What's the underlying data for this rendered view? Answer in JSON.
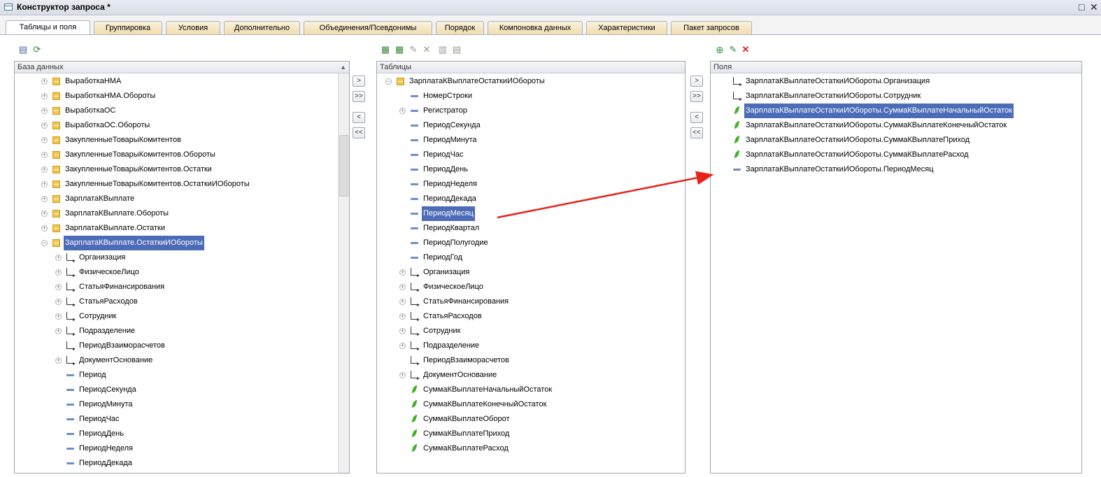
{
  "window": {
    "title": "Конструктор запроса *",
    "maximize": "□",
    "close": "✕"
  },
  "tabs": [
    {
      "label": "Таблицы и поля",
      "active": true
    },
    {
      "label": "Группировка"
    },
    {
      "label": "Условия"
    },
    {
      "label": "Дополнительно"
    },
    {
      "label": "Объединения/Псевдонимы"
    },
    {
      "label": "Порядок"
    },
    {
      "label": "Компоновка данных"
    },
    {
      "label": "Характеристики"
    },
    {
      "label": "Пакет запросов"
    }
  ],
  "database": {
    "header": "База данных",
    "items": [
      {
        "label": "ВыработкаНМА",
        "icon": "table-icon",
        "expand": "+"
      },
      {
        "label": "ВыработкаНМА.Обороты",
        "icon": "table-icon",
        "expand": "+"
      },
      {
        "label": "ВыработкаОС",
        "icon": "table-icon",
        "expand": "+"
      },
      {
        "label": "ВыработкаОС.Обороты",
        "icon": "table-icon",
        "expand": "+"
      },
      {
        "label": "ЗакупленныеТоварыКомитентов",
        "icon": "table-icon",
        "expand": "+"
      },
      {
        "label": "ЗакупленныеТоварыКомитентов.Обороты",
        "icon": "table-icon",
        "expand": "+"
      },
      {
        "label": "ЗакупленныеТоварыКомитентов.Остатки",
        "icon": "table-icon",
        "expand": "+"
      },
      {
        "label": "ЗакупленныеТоварыКомитентов.ОстаткиИОбороты",
        "icon": "table-icon",
        "expand": "+"
      },
      {
        "label": "ЗарплатаКВыплате",
        "icon": "table-icon",
        "expand": "+"
      },
      {
        "label": "ЗарплатаКВыплате.Обороты",
        "icon": "table-icon",
        "expand": "+"
      },
      {
        "label": "ЗарплатаКВыплате.Остатки",
        "icon": "table-icon",
        "expand": "+"
      },
      {
        "label": "ЗарплатаКВыплате.ОстаткиИОбороты",
        "icon": "table-icon",
        "expand": "−",
        "selected": true
      },
      {
        "label": "Организация",
        "icon": "reference-icon",
        "expand": "+",
        "child": true
      },
      {
        "label": "ФизическоеЛицо",
        "icon": "reference-icon",
        "expand": "+",
        "child": true
      },
      {
        "label": "СтатьяФинансирования",
        "icon": "reference-icon",
        "expand": "+",
        "child": true
      },
      {
        "label": "СтатьяРасходов",
        "icon": "reference-icon",
        "expand": "+",
        "child": true
      },
      {
        "label": "Сотрудник",
        "icon": "reference-icon",
        "expand": "+",
        "child": true
      },
      {
        "label": "Подразделение",
        "icon": "reference-icon",
        "expand": "+",
        "child": true
      },
      {
        "label": "ПериодВзаиморасчетов",
        "icon": "reference-icon",
        "child": true
      },
      {
        "label": "ДокументОснование",
        "icon": "reference-icon",
        "expand": "+",
        "child": true
      },
      {
        "label": "Период",
        "icon": "field-icon",
        "child": true
      },
      {
        "label": "ПериодСекунда",
        "icon": "field-icon",
        "child": true
      },
      {
        "label": "ПериодМинута",
        "icon": "field-icon",
        "child": true
      },
      {
        "label": "ПериодЧас",
        "icon": "field-icon",
        "child": true
      },
      {
        "label": "ПериодДень",
        "icon": "field-icon",
        "child": true
      },
      {
        "label": "ПериодНеделя",
        "icon": "field-icon",
        "child": true
      },
      {
        "label": "ПериодДекада",
        "icon": "field-icon",
        "child": true
      }
    ]
  },
  "tables": {
    "header": "Таблицы",
    "items": [
      {
        "label": "ЗарплатаКВыплатеОстаткиИОбороты",
        "icon": "table-icon",
        "expand": "−"
      },
      {
        "label": "НомерСтроки",
        "icon": "field-icon",
        "child": true
      },
      {
        "label": "Регистратор",
        "icon": "field-icon",
        "expand": "+",
        "child": true
      },
      {
        "label": "ПериодСекунда",
        "icon": "field-icon",
        "child": true
      },
      {
        "label": "ПериодМинута",
        "icon": "field-icon",
        "child": true
      },
      {
        "label": "ПериодЧас",
        "icon": "field-icon",
        "child": true
      },
      {
        "label": "ПериодДень",
        "icon": "field-icon",
        "child": true
      },
      {
        "label": "ПериодНеделя",
        "icon": "field-icon",
        "child": true
      },
      {
        "label": "ПериодДекада",
        "icon": "field-icon",
        "child": true
      },
      {
        "label": "ПериодМесяц",
        "icon": "field-icon",
        "child": true,
        "selected": true
      },
      {
        "label": "ПериодКвартал",
        "icon": "field-icon",
        "child": true
      },
      {
        "label": "ПериодПолугодие",
        "icon": "field-icon",
        "child": true
      },
      {
        "label": "ПериодГод",
        "icon": "field-icon",
        "child": true
      },
      {
        "label": "Организация",
        "icon": "reference-icon",
        "expand": "+",
        "child": true
      },
      {
        "label": "ФизическоеЛицо",
        "icon": "reference-icon",
        "expand": "+",
        "child": true
      },
      {
        "label": "СтатьяФинансирования",
        "icon": "reference-icon",
        "expand": "+",
        "child": true
      },
      {
        "label": "СтатьяРасходов",
        "icon": "reference-icon",
        "expand": "+",
        "child": true
      },
      {
        "label": "Сотрудник",
        "icon": "reference-icon",
        "expand": "+",
        "child": true
      },
      {
        "label": "Подразделение",
        "icon": "reference-icon",
        "expand": "+",
        "child": true
      },
      {
        "label": "ПериодВзаиморасчетов",
        "icon": "reference-icon",
        "child": true
      },
      {
        "label": "ДокументОснование",
        "icon": "reference-icon",
        "expand": "+",
        "child": true
      },
      {
        "label": "СуммаКВыплатеНачальныйОстаток",
        "icon": "resource-icon",
        "child": true
      },
      {
        "label": "СуммаКВыплатеКонечныйОстаток",
        "icon": "resource-icon",
        "child": true
      },
      {
        "label": "СуммаКВыплатеОборот",
        "icon": "resource-icon",
        "child": true
      },
      {
        "label": "СуммаКВыплатеПриход",
        "icon": "resource-icon",
        "child": true
      },
      {
        "label": "СуммаКВыплатеРасход",
        "icon": "resource-icon",
        "child": true
      }
    ]
  },
  "fields": {
    "header": "Поля",
    "items": [
      {
        "label": "ЗарплатаКВыплатеОстаткиИОбороты.Организация",
        "icon": "reference-icon"
      },
      {
        "label": "ЗарплатаКВыплатеОстаткиИОбороты.Сотрудник",
        "icon": "reference-icon"
      },
      {
        "label": "ЗарплатаКВыплатеОстаткиИОбороты.СуммаКВыплатеНачальныйОстаток",
        "icon": "resource-icon",
        "selected": true
      },
      {
        "label": "ЗарплатаКВыплатеОстаткиИОбороты.СуммаКВыплатеКонечныйОстаток",
        "icon": "resource-icon"
      },
      {
        "label": "ЗарплатаКВыплатеОстаткиИОбороты.СуммаКВыплатеПриход",
        "icon": "resource-icon"
      },
      {
        "label": "ЗарплатаКВыплатеОстаткиИОбороты.СуммаКВыплатеРасход",
        "icon": "resource-icon"
      },
      {
        "label": "ЗарплатаКВыплатеОстаткиИОбороты.ПериодМесяц",
        "icon": "field-icon"
      }
    ]
  },
  "move_buttons": [
    ">",
    ">>",
    "<",
    "<<"
  ],
  "colors": {
    "selection": "#4c6cb8",
    "arrow": "#e8221b",
    "tab_bg": "#f1ddb0"
  }
}
